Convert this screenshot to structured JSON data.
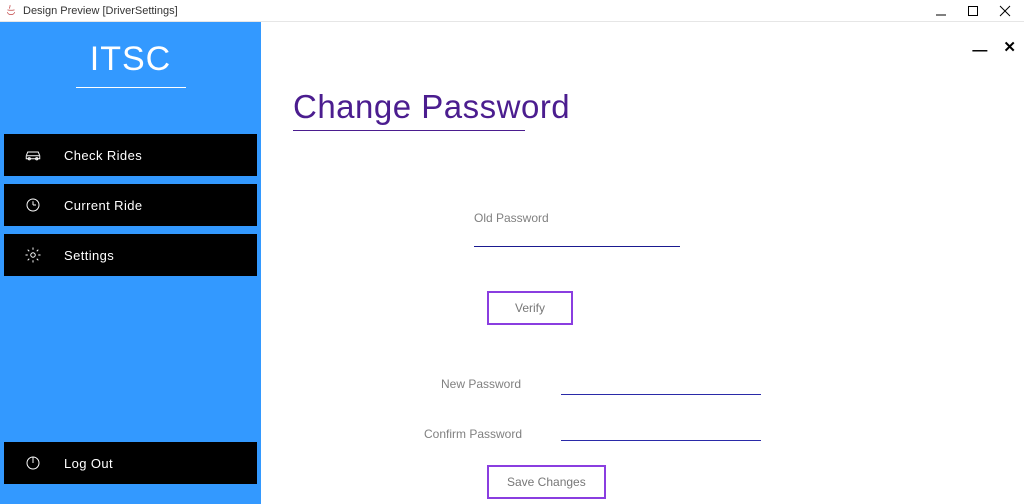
{
  "window": {
    "title": "Design Preview [DriverSettings]"
  },
  "brand": "ITSC",
  "sidebar": {
    "items": [
      {
        "label": "Check Rides",
        "icon": "car-icon"
      },
      {
        "label": "Current Ride",
        "icon": "clock-icon"
      },
      {
        "label": "Settings",
        "icon": "gear-icon"
      }
    ],
    "logout": {
      "label": "Log Out",
      "icon": "power-icon"
    }
  },
  "page": {
    "heading": "Change Password",
    "old_password_label": "Old Password",
    "old_password_value": "",
    "verify_label": "Verify",
    "new_password_label": "New Password",
    "new_password_value": "",
    "confirm_password_label": "Confirm Password",
    "confirm_password_value": "",
    "save_label": "Save Changes"
  },
  "colors": {
    "sidebar_bg": "#3399ff",
    "accent_purple": "#4b1d8f",
    "button_border": "#8a3ee0",
    "input_underline": "#2a2aa8"
  }
}
